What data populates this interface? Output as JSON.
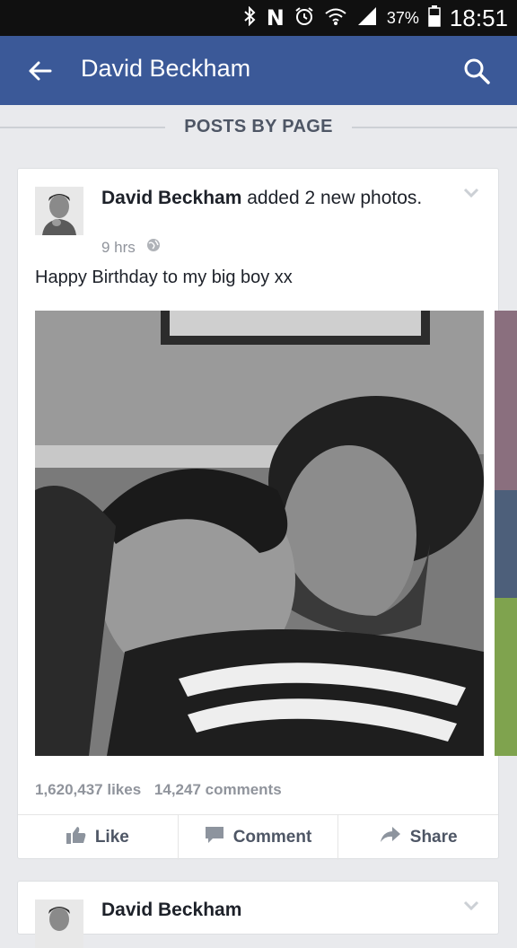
{
  "status_bar": {
    "icons": [
      "bluetooth-icon",
      "nfc-icon",
      "alarm-icon",
      "wifi-icon",
      "signal-icon",
      "battery-icon"
    ],
    "battery_percent": "37%",
    "time": "18:51"
  },
  "app_bar": {
    "title": "David Beckham",
    "color": "#3b5998"
  },
  "section": {
    "title": "POSTS BY PAGE"
  },
  "post": {
    "author": "David Beckham",
    "action": " added 2 new photos.",
    "time": "9 hrs",
    "text": "Happy Birthday to my big boy xx",
    "likes": "1,620,437 likes",
    "comments": "14,247 comments",
    "actions": {
      "like": "Like",
      "comment": "Comment",
      "share": "Share"
    }
  },
  "next_post": {
    "author": "David Beckham"
  }
}
